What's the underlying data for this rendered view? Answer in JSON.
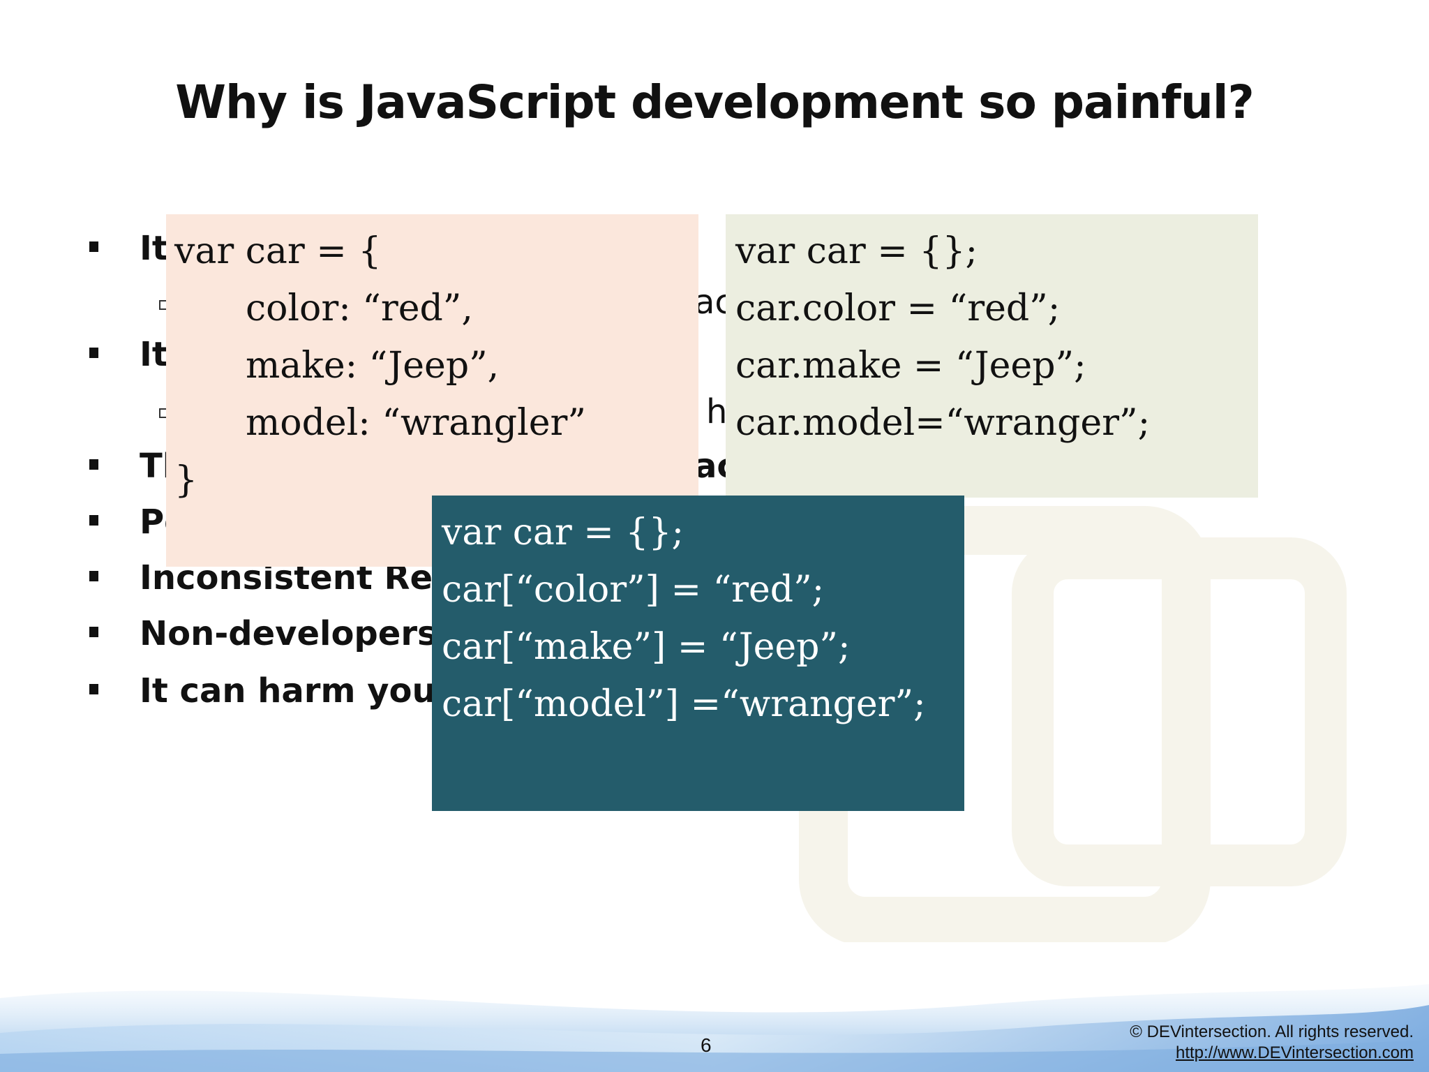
{
  "slide": {
    "title": "Why is JavaScript development so painful?",
    "page_number": "6"
  },
  "bullets": [
    {
      "text": "It",
      "visible_fragment": "It"
    },
    {
      "text": "It",
      "visible_fragment": "It"
    },
    {
      "text": "Th",
      "visible_fragment": "Th"
    },
    {
      "text": "Pe",
      "visible_fragment": "Pe"
    },
    {
      "text": "Inconsistent Resu",
      "visible_fragment": "Inconsistent Resu"
    },
    {
      "text": "Non-developers a",
      "visible_fragment": "Non-developers a"
    },
    {
      "text": "It can harm you fa",
      "visible_fragment": "It can harm you fa"
    }
  ],
  "bullet_fragments": {
    "right_1": "acl",
    "right_2": "h",
    "right_3": "act"
  },
  "code_boxes": {
    "object_literal": [
      "var car = {",
      "color: “red”,",
      "make: “Jeep”,",
      "model: “wrangler”",
      "}"
    ],
    "dot_notation": [
      "var car = {};",
      "car.color = “red”;",
      "car.make = “Jeep”;",
      "car.model=“wranger”;"
    ],
    "bracket_notation": [
      "var car = {};",
      "car[“color”] = “red”;",
      "car[“make”] = “Jeep”;",
      "car[“model”] =“wranger”;"
    ]
  },
  "footer": {
    "copyright": "© DEVintersection. All rights reserved.",
    "url": "http://www.DEVintersection.com"
  },
  "colors": {
    "box_object_literal": "#fbe7dc",
    "box_dot_notation": "#eceee0",
    "box_bracket_notation": "#245c6b"
  }
}
